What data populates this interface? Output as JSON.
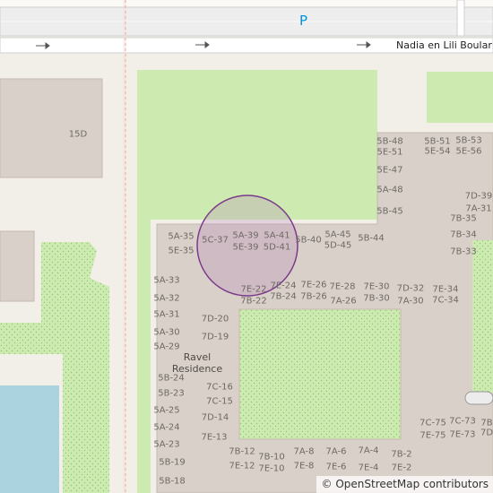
{
  "map": {
    "road_name": "Nadia en Lili Boular",
    "parking_symbol": "P",
    "complex_name_line1": "Ravel",
    "complex_name_line2": "Residence",
    "building_15d": "15D",
    "attribution": "© OpenStreetMap contributors",
    "colors": {
      "background": "#f2efe9",
      "building": "#d9d0c9",
      "grass": "#cdebb0",
      "water": "#aad3df",
      "marker": "#7b3a8a",
      "parking": "#0092da"
    },
    "labels": {
      "l0": "5B-48",
      "l1": "5B-51",
      "l2": "5B-53",
      "l3": "5E-51",
      "l4": "5E-54",
      "l5": "5E-56",
      "l6": "5E-47",
      "l7": "5A-48",
      "l8": "5B-45",
      "l9": "7D-39",
      "l10": "7A-31",
      "l11": "7B-35",
      "l12": "7B-34",
      "l13": "7B-33",
      "l14": "5A-35",
      "l15": "5C-37",
      "l16": "5E-35",
      "l17": "5A-39",
      "l18": "5E-39",
      "l19": "5A-41",
      "l20": "5D-41",
      "l21": "5B-40",
      "l22": "5A-45",
      "l23": "5D-45",
      "l24": "5B-44",
      "l25": "5A-33",
      "l26": "5A-32",
      "l27": "5A-31",
      "l28": "5A-30",
      "l29": "5A-29",
      "l30": "5B-24",
      "l31": "5B-23",
      "l32": "5A-25",
      "l33": "5A-24",
      "l34": "5A-23",
      "l35": "5B-19",
      "l36": "5B-18",
      "l37": "7E-22",
      "l38": "7B-22",
      "l39": "7E-24",
      "l40": "7B-24",
      "l41": "7E-26",
      "l42": "7B-26",
      "l43": "7E-28",
      "l44": "7A-26",
      "l45": "7E-30",
      "l46": "7B-30",
      "l47": "7D-32",
      "l48": "7A-30",
      "l49": "7E-34",
      "l50": "7C-34",
      "l51": "7D-20",
      "l52": "7D-19",
      "l53": "7C-16",
      "l54": "7C-15",
      "l55": "7D-14",
      "l56": "7E-13",
      "l57": "7B-12",
      "l58": "7E-12",
      "l59": "7B-10",
      "l60": "7E-10",
      "l61": "7A-8",
      "l62": "7E-8",
      "l63": "7A-6",
      "l64": "7E-6",
      "l65": "7A-4",
      "l66": "7E-4",
      "l67": "7B-2",
      "l68": "7E-2",
      "l69": "7C-75",
      "l70": "7E-75",
      "l71": "7C-73",
      "l72": "7E-73",
      "l73": "7B",
      "l74": "7D"
    }
  }
}
